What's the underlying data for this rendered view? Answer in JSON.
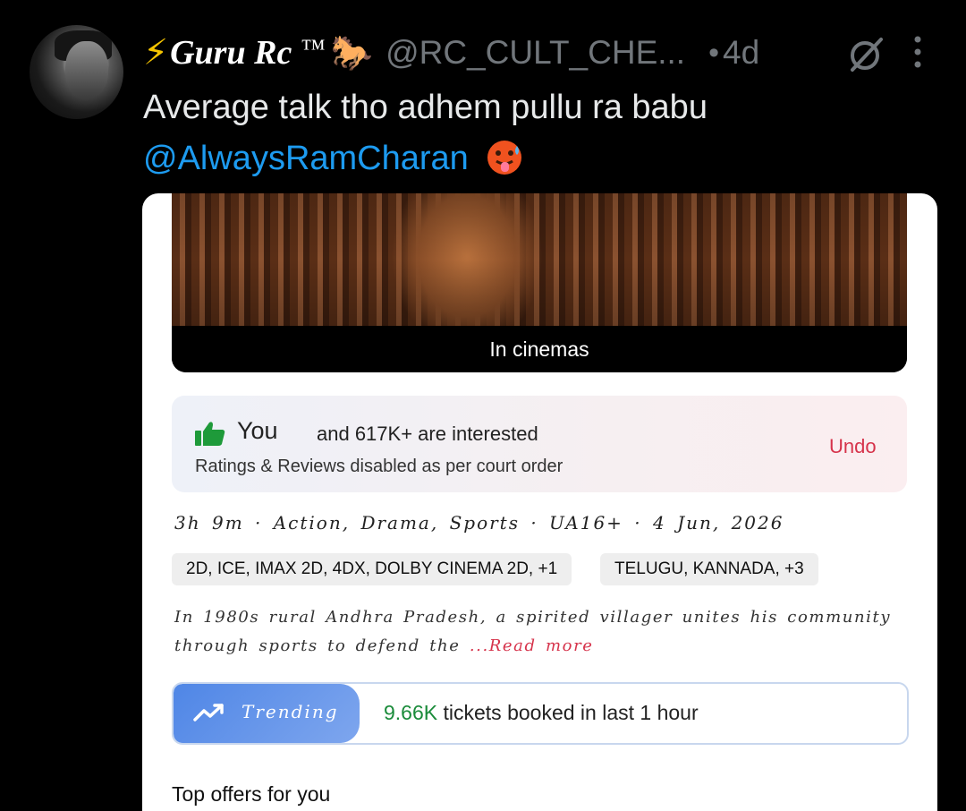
{
  "author": {
    "bolt": "⚡",
    "display_name": "Guru Rc",
    "tm": "™",
    "emoji": "🐎",
    "handle": "@RC_CULT_CHE...",
    "separator": "•",
    "timestamp": "4d"
  },
  "tweet": {
    "text": "Average talk tho adhem pullu ra babu",
    "mention": "@AlwaysRamCharan"
  },
  "icons": {
    "avatar": "avatar-photo",
    "grok": "grok-icon",
    "more": "more-options-icon",
    "reaction_emoji": "hot-face-emoji",
    "thumb": "thumbs-up-icon",
    "trend": "trending-up-icon"
  },
  "screenshot": {
    "banner": "In cinemas",
    "interest": {
      "you": "You",
      "rest": "and 617K+  are interested",
      "note": "Ratings & Reviews disabled as per court order",
      "undo": "Undo"
    },
    "meta": "3h 9m · Action, Drama, Sports · UA16+ · 4 Jun, 2026",
    "formats": "2D, ICE, IMAX 2D, 4DX, DOLBY CINEMA 2D,  +1",
    "languages": "TELUGU, KANNADA,  +3",
    "description": "In 1980s rural Andhra Pradesh, a spirited villager unites his community through sports to defend the ",
    "read_more": "...Read more",
    "trending_label": "Trending",
    "tickets_count": "9.66K",
    "tickets_text": " tickets booked in last 1 hour",
    "offers_heading": "Top offers for you"
  },
  "colors": {
    "background": "#000000",
    "text": "#e7e9ea",
    "muted": "#71767b",
    "link": "#1d9bf0",
    "accent_red": "#d6334b",
    "green": "#1a8b3a"
  }
}
